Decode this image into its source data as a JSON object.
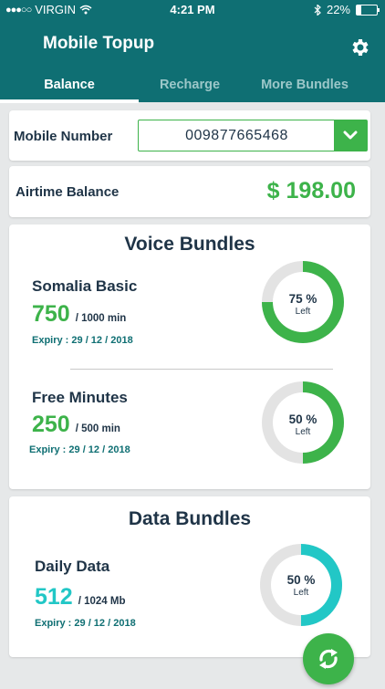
{
  "status": {
    "carrier": "VIRGIN",
    "time": "4:21 PM",
    "battery": "22%",
    "battery_fraction": 0.22
  },
  "header": {
    "title": "Mobile Topup",
    "settings_icon": "gear-icon"
  },
  "tabs": [
    {
      "label": "Balance",
      "active": true
    },
    {
      "label": "Recharge",
      "active": false
    },
    {
      "label": "More Bundles",
      "active": false
    }
  ],
  "mobile": {
    "label": "Mobile Number",
    "value": "009877665468"
  },
  "airtime": {
    "label": "Airtime Balance",
    "value": "$ 198.00"
  },
  "voice": {
    "title": "Voice Bundles",
    "items": [
      {
        "name": "Somalia Basic",
        "amount": "750",
        "total": "/ 1000 min",
        "expiry": "Expiry : 29 / 12 / 2018",
        "percent_text": "75 %",
        "left_text": "Left",
        "fraction": 0.75
      },
      {
        "name": "Free Minutes",
        "amount": "250",
        "total": "/ 500 min",
        "expiry": "Expiry : 29 / 12 / 2018",
        "percent_text": "50 %",
        "left_text": "Left",
        "fraction": 0.5
      }
    ]
  },
  "data": {
    "title": "Data Bundles",
    "items": [
      {
        "name": "Daily Data",
        "amount": "512",
        "total": "/ 1024 Mb",
        "expiry": "Expiry : 29 / 12 / 2018",
        "percent_text": "50 %",
        "left_text": "Left",
        "fraction": 0.5
      }
    ]
  },
  "colors": {
    "header": "#0f6f73",
    "green": "#3db34a",
    "cyan": "#22c7c6",
    "track": "#e3e3e3",
    "expiry": "#0f6f73"
  }
}
